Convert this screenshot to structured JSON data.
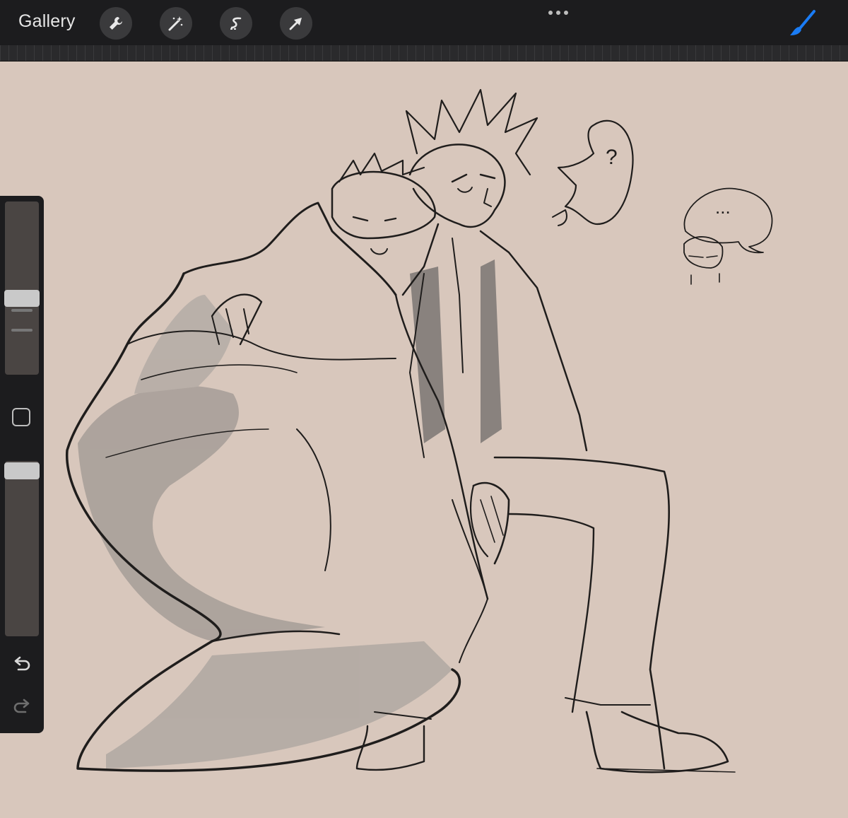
{
  "toolbar": {
    "gallery_label": "Gallery",
    "tools": [
      {
        "name": "wrench-icon"
      },
      {
        "name": "magic-wand-icon"
      },
      {
        "name": "selection-s-icon"
      },
      {
        "name": "move-arrow-icon"
      }
    ],
    "more_icon": "more-dots-icon",
    "brush_icon": "brush-icon",
    "accent_color": "#1a7cf5"
  },
  "canvas": {
    "background_color": "#d8c7bc",
    "speech_bubble_1": "?",
    "speech_bubble_2": "..."
  },
  "sidebar": {
    "brush_size_level": 0.55,
    "opacity_level": 0.95,
    "modify_icon": "square-icon",
    "undo_icon": "undo-icon",
    "redo_icon": "redo-icon"
  }
}
